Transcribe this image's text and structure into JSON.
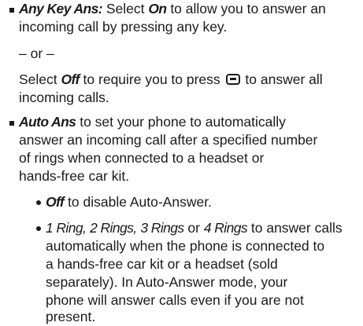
{
  "item1": {
    "term": "Any Key Ans:",
    "select_word": "Select",
    "on_value": "On",
    "text_a": "to allow you to answer an",
    "text_b": "incoming call by pressing any key.",
    "or_separator": "– or –",
    "off_value": "Off",
    "text_c": "to require you to press",
    "text_d": "to answer all",
    "text_e": "incoming calls.",
    "key_icon": "talk-key-icon"
  },
  "item2": {
    "term": "Auto Ans",
    "line1": "to set your phone to automatically",
    "line2": "answer an incoming call after a specified number",
    "line3": "of rings when connected to a headset or",
    "line4": "hands-free car kit."
  },
  "sub1": {
    "term": "Off",
    "text": "to disable Auto-Answer."
  },
  "sub2": {
    "opt1": "1 Ring,",
    "opt2": "2 Rings,",
    "opt3": "3 Rings",
    "or_word": "or",
    "opt4": "4 Rings",
    "line1_tail": "to answer calls",
    "line2": "automatically when the phone is connected to",
    "line3": "a hands-free car kit or a headset (sold",
    "line4": "separately). In Auto-Answer mode, your",
    "line5": "phone will answer calls even if you are not",
    "line6": "present."
  }
}
